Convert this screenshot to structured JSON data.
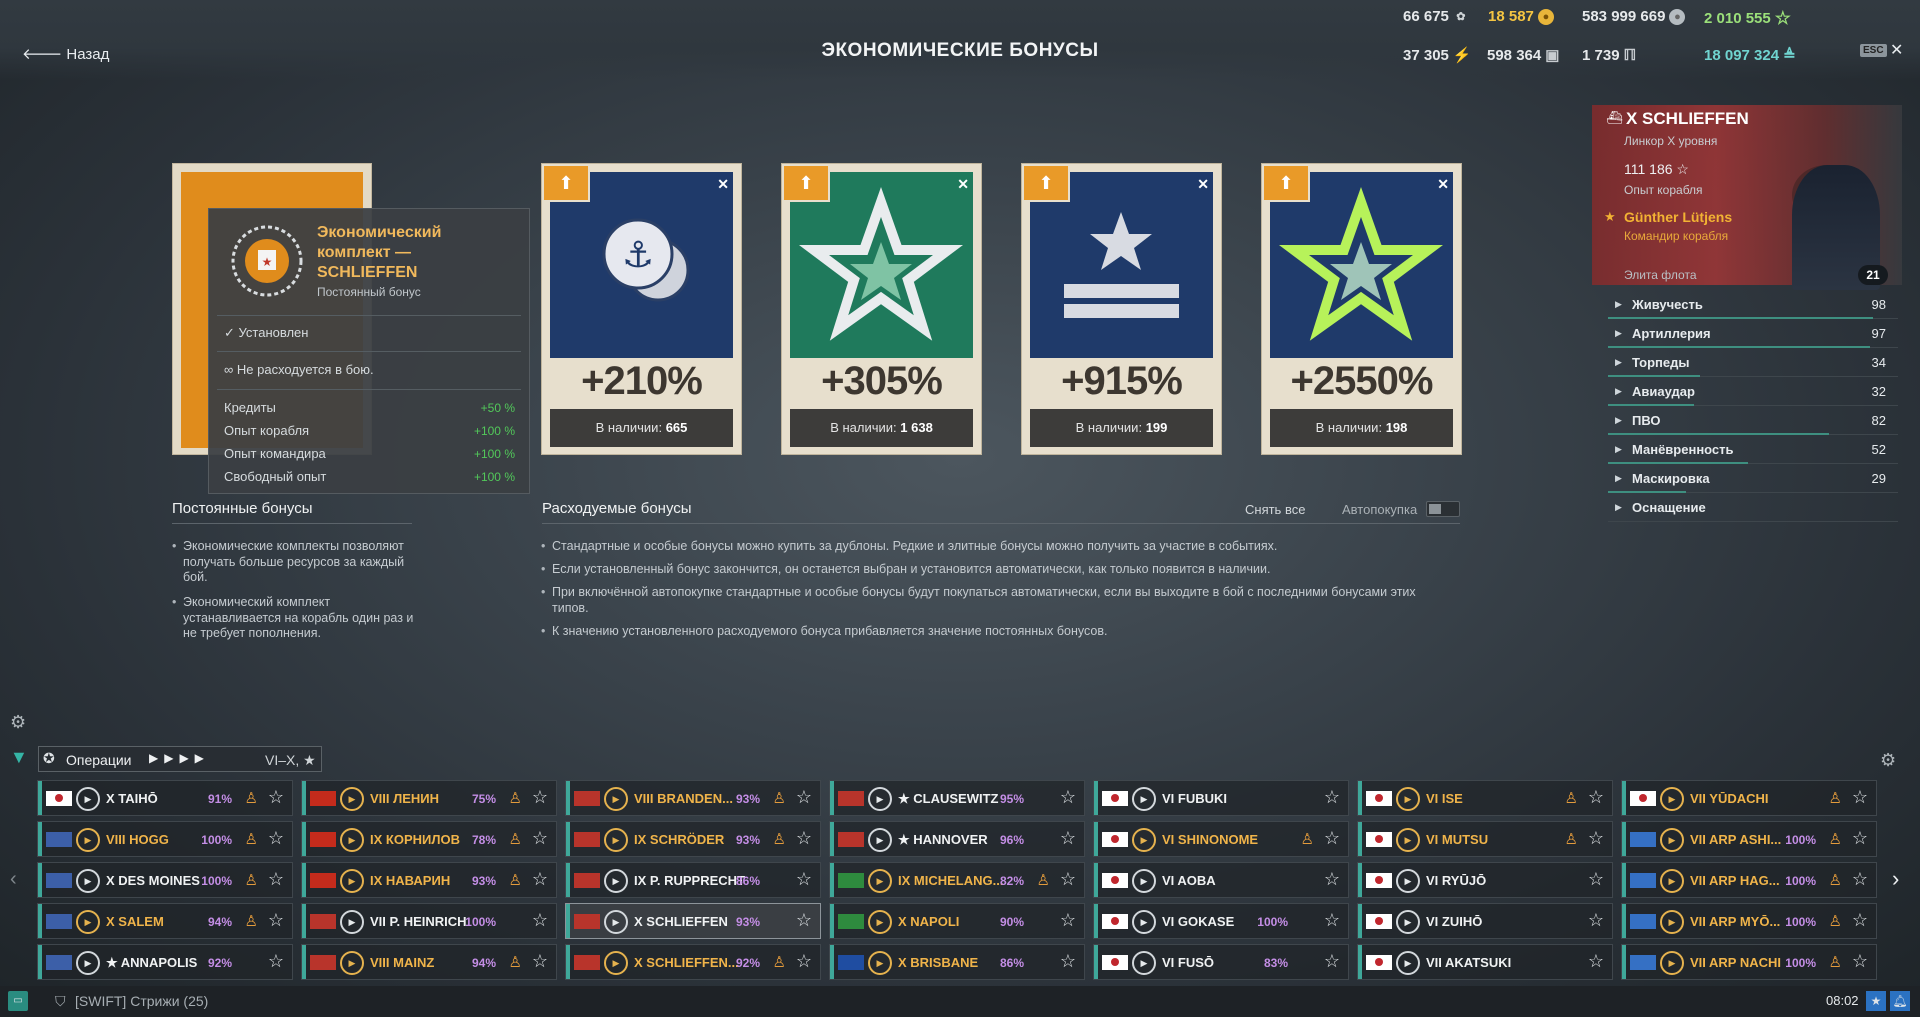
{
  "header": {
    "back_label": "Назад",
    "title": "ЭКОНОМИЧЕСКИЕ БОНУСЫ",
    "res_signals": "66 675",
    "res_doubloons": "18 587",
    "res_credits": "583 999 669",
    "res_free_xp": "2 010 555",
    "res_coal": "37 305",
    "res_steel": "598 364",
    "res_research": "1 739",
    "res_elite_xp": "18 097 324",
    "esc": "ESC",
    "close": "✕"
  },
  "permanent_tooltip": {
    "title_l1": "Экономический",
    "title_l2": "комплект —",
    "title_l3": "SCHLIEFFEN",
    "subtitle": "Постоянный бонус",
    "installed": "Установлен",
    "not_consumed": "Не расходуется в бою.",
    "rows": [
      {
        "label": "Кредиты",
        "value": "+50 %"
      },
      {
        "label": "Опыт корабля",
        "value": "+100 %"
      },
      {
        "label": "Опыт командира",
        "value": "+100 %"
      },
      {
        "label": "Свободный опыт",
        "value": "+100 %"
      }
    ]
  },
  "cards": [
    {
      "pct": "+210%",
      "stock_label": "В наличии:",
      "stock": "665"
    },
    {
      "pct": "+305%",
      "stock_label": "В наличии:",
      "stock": "1 638"
    },
    {
      "pct": "+915%",
      "stock_label": "В наличии:",
      "stock": "199"
    },
    {
      "pct": "+2550%",
      "stock_label": "В наличии:",
      "stock": "198"
    }
  ],
  "permanent_section": {
    "title": "Постоянные бонусы",
    "bullets": [
      "Экономические комплекты позволяют получать больше ресурсов за каждый бой.",
      "Экономический комплект устанавливается на корабль один раз и не требует пополнения."
    ]
  },
  "consumable_section": {
    "title": "Расходуемые бонусы",
    "remove_all": "Снять все",
    "autobuy": "Автопокупка",
    "bullets": [
      "Стандартные и особые бонусы можно купить за дублоны. Редкие и элитные бонусы можно получить за участие в событиях.",
      "Если установленный бонус закончится, он останется выбран и установится автоматически, как только появится в наличии.",
      "При включённой автопокупке стандартные и особые бонусы будут покупаться автоматически, если вы выходите в бой с последними бонусами этих типов.",
      "К значению установленного расходуемого бонуса прибавляется значение постоянных бонусов."
    ]
  },
  "ship": {
    "name": "X SCHLIEFFEN",
    "type": "Линкор X уровня",
    "xp": "111 186",
    "xp_label": "Опыт корабля",
    "commander": "Günther Lütjens",
    "commander_label": "Командир корабля",
    "elite": "Элита флота",
    "commander_level": "21",
    "stats": [
      {
        "name": "Живучесть",
        "value": "98",
        "fill": 0.98
      },
      {
        "name": "Артиллерия",
        "value": "97",
        "fill": 0.97
      },
      {
        "name": "Торпеды",
        "value": "34",
        "fill": 0.34
      },
      {
        "name": "Авиаудар",
        "value": "32",
        "fill": 0.32
      },
      {
        "name": "ПВО",
        "value": "82",
        "fill": 0.82
      },
      {
        "name": "Манёвренность",
        "value": "52",
        "fill": 0.52
      },
      {
        "name": "Маскировка",
        "value": "29",
        "fill": 0.29
      },
      {
        "name": "Оснащение",
        "value": "",
        "fill": 0
      }
    ]
  },
  "filters": {
    "mode": "Операции",
    "tiers": "VI–X,"
  },
  "columns": [
    [
      {
        "flag": "jp",
        "name": "X TAIHŌ",
        "pct": "91%",
        "prem": false,
        "cmd": true
      },
      {
        "flag": "us",
        "name": "VIII HOGG",
        "pct": "100%",
        "prem": true,
        "cmd": true
      },
      {
        "flag": "us",
        "name": "X DES MOINES",
        "pct": "100%",
        "prem": false,
        "cmd": true
      },
      {
        "flag": "us",
        "name": "X SALEM",
        "pct": "94%",
        "prem": true,
        "cmd": true
      },
      {
        "flag": "us",
        "name": "★ ANNAPOLIS",
        "pct": "92%",
        "prem": false,
        "cmd": false
      }
    ],
    [
      {
        "flag": "su",
        "name": "VIII ЛЕНИН",
        "pct": "75%",
        "prem": true,
        "cmd": true
      },
      {
        "flag": "su",
        "name": "IX КОРНИЛОВ",
        "pct": "78%",
        "prem": true,
        "cmd": true
      },
      {
        "flag": "su",
        "name": "IX НАВАРИН",
        "pct": "93%",
        "prem": true,
        "cmd": true
      },
      {
        "flag": "de",
        "name": "VII P. HEINRICH",
        "pct": "100%",
        "prem": false,
        "cmd": false
      },
      {
        "flag": "de",
        "name": "VIII MAINZ",
        "pct": "94%",
        "prem": true,
        "cmd": true
      }
    ],
    [
      {
        "flag": "de",
        "name": "VIII BRANDEN...",
        "pct": "93%",
        "prem": true,
        "cmd": true
      },
      {
        "flag": "de",
        "name": "IX SCHRÖDER",
        "pct": "93%",
        "prem": true,
        "cmd": true
      },
      {
        "flag": "de",
        "name": "IX P. RUPPRECHT",
        "pct": "86%",
        "prem": false,
        "cmd": false
      },
      {
        "flag": "de",
        "name": "X SCHLIEFFEN",
        "pct": "93%",
        "prem": false,
        "cmd": false,
        "sel": true
      },
      {
        "flag": "de",
        "name": "X SCHLIEFFEN...",
        "pct": "92%",
        "prem": true,
        "cmd": true
      }
    ],
    [
      {
        "flag": "de",
        "name": "★ CLAUSEWITZ",
        "pct": "95%",
        "prem": false,
        "cmd": false
      },
      {
        "flag": "de",
        "name": "★ HANNOVER",
        "pct": "96%",
        "prem": false,
        "cmd": false
      },
      {
        "flag": "it",
        "name": "IX MICHELANG...",
        "pct": "82%",
        "prem": true,
        "cmd": true
      },
      {
        "flag": "it",
        "name": "X NAPOLI",
        "pct": "90%",
        "prem": true,
        "cmd": false
      },
      {
        "flag": "eu",
        "name": "X BRISBANE",
        "pct": "86%",
        "prem": true,
        "cmd": false
      }
    ],
    [
      {
        "flag": "jp",
        "name": "VI FUBUKI",
        "pct": "",
        "prem": false,
        "cmd": false
      },
      {
        "flag": "jp",
        "name": "VI SHINONOME",
        "pct": "",
        "prem": true,
        "cmd": true
      },
      {
        "flag": "jp",
        "name": "VI AOBA",
        "pct": "",
        "prem": false,
        "cmd": false
      },
      {
        "flag": "jp",
        "name": "VI GOKASE",
        "pct": "100%",
        "prem": false,
        "cmd": false
      },
      {
        "flag": "jp",
        "name": "VI FUSŌ",
        "pct": "83%",
        "prem": false,
        "cmd": false
      }
    ],
    [
      {
        "flag": "jp",
        "name": "VI ISE",
        "pct": "",
        "prem": true,
        "cmd": true
      },
      {
        "flag": "jp",
        "name": "VI MUTSU",
        "pct": "",
        "prem": true,
        "cmd": true
      },
      {
        "flag": "jp",
        "name": "VI RYŪJŌ",
        "pct": "",
        "prem": false,
        "cmd": false
      },
      {
        "flag": "jp",
        "name": "VI ZUIHŌ",
        "pct": "",
        "prem": false,
        "cmd": false
      },
      {
        "flag": "jp",
        "name": "VII AKATSUKI",
        "pct": "",
        "prem": false,
        "cmd": false
      }
    ],
    [
      {
        "flag": "jp",
        "name": "VII YŪDACHI",
        "pct": "",
        "prem": true,
        "cmd": true
      },
      {
        "flag": "arp",
        "name": "VII ARP ASHI...",
        "pct": "100%",
        "prem": true,
        "cmd": true
      },
      {
        "flag": "arp",
        "name": "VII ARP HAG...",
        "pct": "100%",
        "prem": true,
        "cmd": true
      },
      {
        "flag": "arp",
        "name": "VII ARP MYŌ...",
        "pct": "100%",
        "prem": true,
        "cmd": true
      },
      {
        "flag": "arp",
        "name": "VII ARP NACHI",
        "pct": "100%",
        "prem": true,
        "cmd": true
      }
    ]
  ],
  "footer": {
    "clan": "[SWIFT] Стрижи (25)",
    "clock": "08:02"
  }
}
